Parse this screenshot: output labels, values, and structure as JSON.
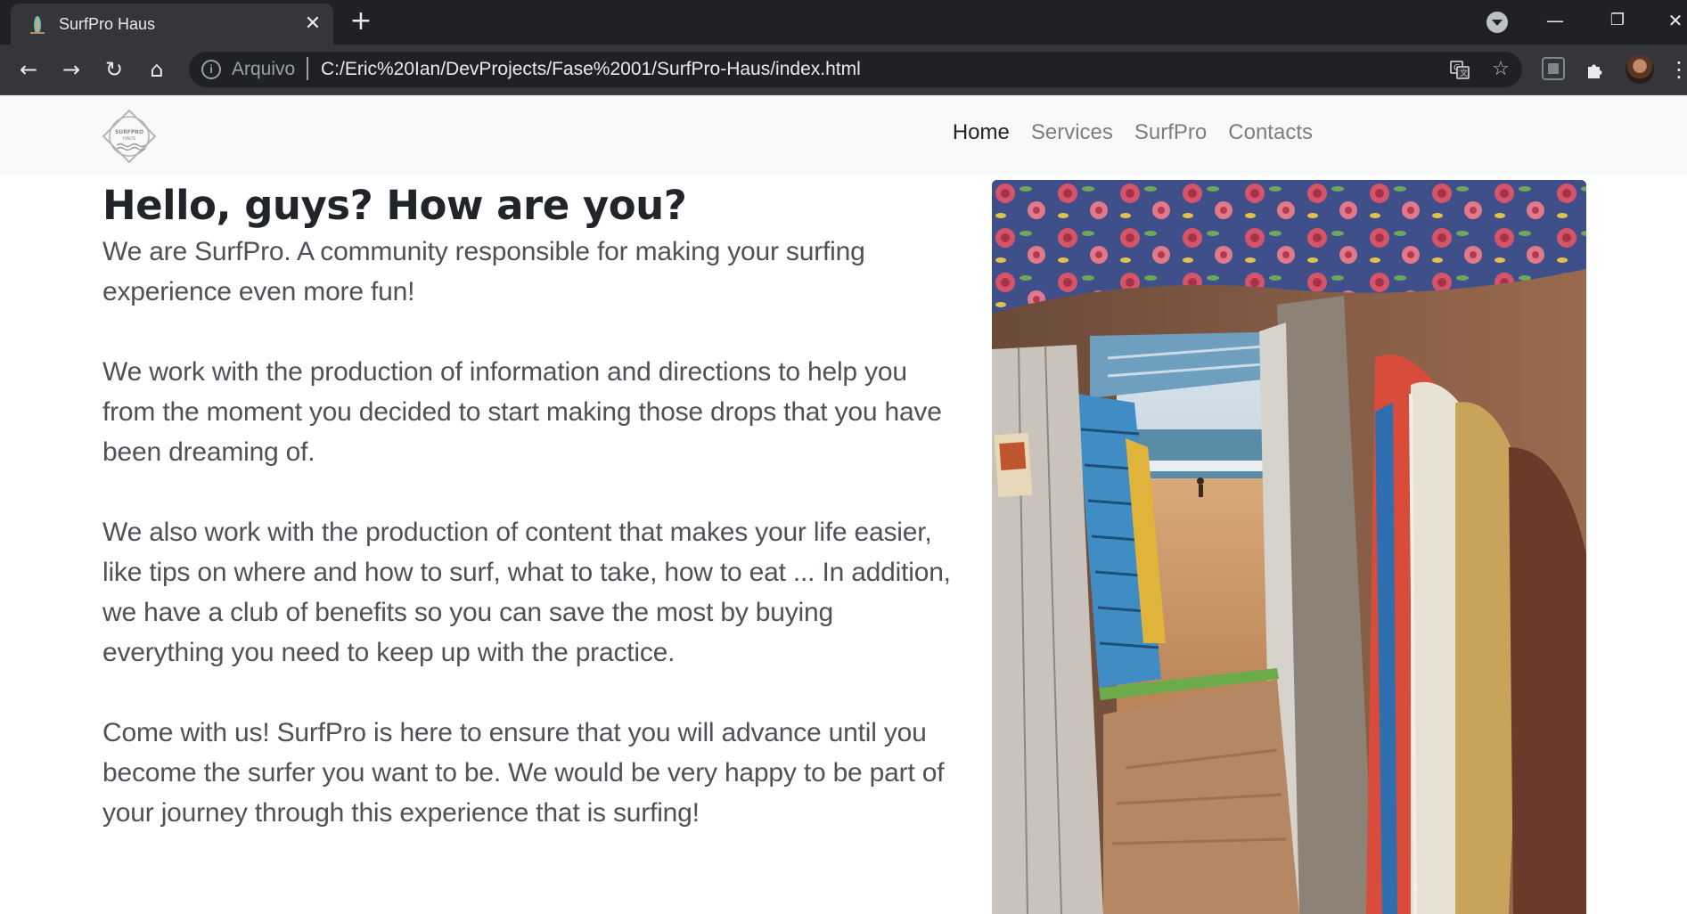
{
  "browser": {
    "tab": {
      "title": "SurfPro Haus",
      "close": "✕"
    },
    "new_tab": "+",
    "window_controls": {
      "minimize": "—",
      "restore": "❐",
      "close": "✕"
    },
    "nav": {
      "back": "←",
      "forward": "→",
      "reload": "↻",
      "home": "⌂"
    },
    "omnibox": {
      "scheme_label": "Arquivo",
      "url": "C:/Eric%20Ian/DevProjects/Fase%2001/SurfPro-Haus/index.html"
    },
    "icons": [
      "info-icon",
      "translate-icon",
      "star-icon",
      "extension-icon",
      "puzzle-icon",
      "avatar",
      "menu-icon"
    ]
  },
  "site": {
    "logo_text": "SURFPRO HAUS",
    "nav": [
      {
        "label": "Home",
        "active": true
      },
      {
        "label": "Services",
        "active": false
      },
      {
        "label": "SurfPro",
        "active": false
      },
      {
        "label": "Contacts",
        "active": false
      }
    ],
    "headline": "Hello, guys? How are you?",
    "paragraphs": [
      "We are SurfPro. A community responsible for making your surfing experience even more fun!",
      "We work with the production of information and directions to help you from the moment you decided to start making those drops that you have been dreaming of.",
      "We also work with the production of content that makes your life easier, like tips on where and how to surf, what to take, how to eat ... In addition, we have a club of benefits so you can save the most by buying everything you need to keep up with the practice.",
      "Come with us! SurfPro is here to ensure that you will advance until you become the surfer you want to be. We would be very happy to be part of your journey through this experience that is surfing!"
    ]
  },
  "colors": {
    "chrome_dark": "#202124",
    "chrome_toolbar": "#35363a",
    "navbar_bg": "#f8f9fa",
    "nav_active": "#222222",
    "nav_inactive": "#7d7d7d",
    "text_body": "#4e5256",
    "heading": "#212529"
  }
}
